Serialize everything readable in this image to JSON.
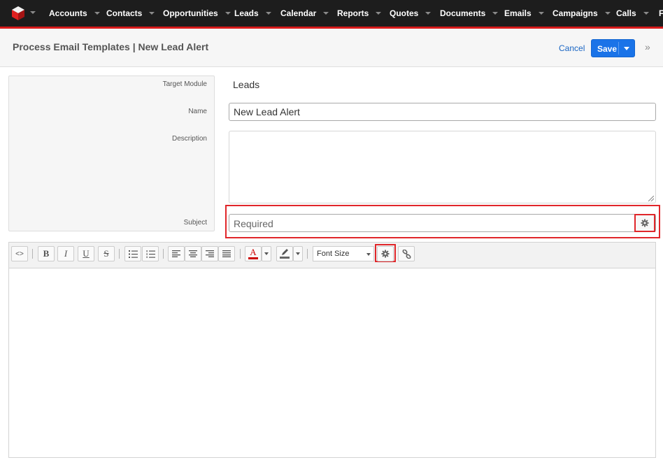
{
  "nav": {
    "logo_icon": "sugar-cube-icon",
    "items": [
      "Accounts",
      "Contacts",
      "Opportunities",
      "Leads",
      "Calendar",
      "Reports",
      "Quotes",
      "Documents",
      "Emails",
      "Campaigns",
      "Calls",
      "F"
    ]
  },
  "header": {
    "title": "Process Email Templates | New Lead Alert",
    "cancel": "Cancel",
    "save": "Save"
  },
  "form": {
    "target_module_label": "Target Module",
    "target_module_value": "Leads",
    "name_label": "Name",
    "name_value": "New Lead Alert",
    "description_label": "Description",
    "description_value": "",
    "subject_label": "Subject",
    "subject_placeholder": "Required"
  },
  "toolbar": {
    "source": "<>",
    "bold": "B",
    "italic": "I",
    "underline": "U",
    "strike": "S",
    "text_color": "A",
    "font_size": "Font Size"
  },
  "colors": {
    "nav_bg": "#1d1d1d",
    "accent_red": "#d81a1a",
    "save_blue": "#1a73e8",
    "highlight": "#e0262a"
  }
}
